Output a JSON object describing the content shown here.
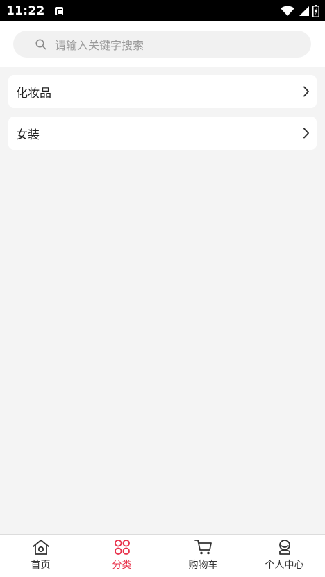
{
  "status_bar": {
    "time": "11:22",
    "icons": [
      "notification-a-icon",
      "wifi-icon",
      "signal-icon",
      "battery-icon"
    ]
  },
  "search": {
    "placeholder": "请输入关键字搜索",
    "icon": "search-icon"
  },
  "categories": [
    {
      "label": "化妆品",
      "icon": "chevron-right-icon"
    },
    {
      "label": "女装",
      "icon": "chevron-right-icon"
    }
  ],
  "tab_bar": {
    "active_color": "#e8304a",
    "tabs": [
      {
        "label": "首页",
        "icon": "home-icon",
        "active": false
      },
      {
        "label": "分类",
        "icon": "category-grid-icon",
        "active": true
      },
      {
        "label": "购物车",
        "icon": "shopping-cart-icon",
        "active": false
      },
      {
        "label": "个人中心",
        "icon": "user-profile-icon",
        "active": false
      }
    ]
  }
}
